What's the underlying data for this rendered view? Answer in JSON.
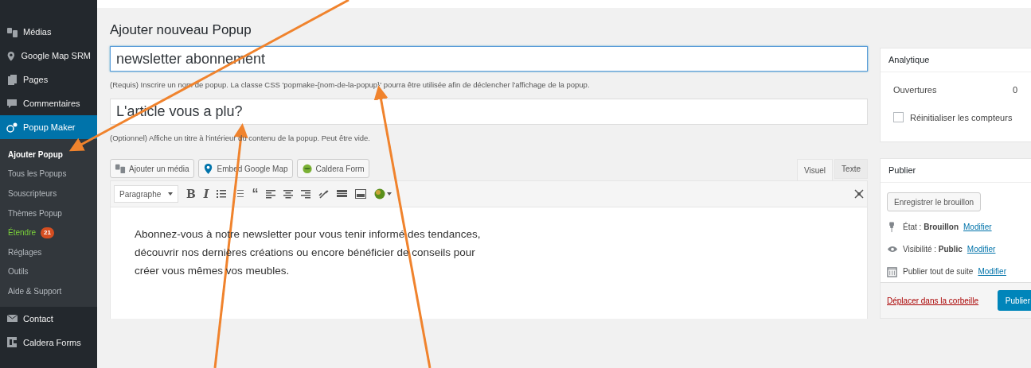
{
  "sidebar": {
    "items": [
      {
        "label": "Médias",
        "selected": false
      },
      {
        "label": "Google Map SRM",
        "selected": false
      },
      {
        "label": "Pages",
        "selected": false
      },
      {
        "label": "Commentaires",
        "selected": false
      },
      {
        "label": "Popup Maker",
        "selected": true,
        "children": [
          {
            "label": "Ajouter Popup",
            "selected": true
          },
          {
            "label": "Tous les Popups",
            "selected": false
          },
          {
            "label": "Souscripteurs",
            "selected": false
          },
          {
            "label": "Thèmes Popup",
            "selected": false
          },
          {
            "label": "Étendre",
            "selected": false,
            "color": "#7ad03a",
            "badge": "21"
          },
          {
            "label": "Réglages",
            "selected": false
          },
          {
            "label": "Outils",
            "selected": false
          },
          {
            "label": "Aide & Support",
            "selected": false
          }
        ]
      },
      {
        "label": "Contact",
        "selected": false
      },
      {
        "label": "Caldera Forms",
        "selected": false
      }
    ]
  },
  "page_title": "Ajouter nouveau Popup",
  "name_field": {
    "value": "newsletter abonnement",
    "help": "(Requis) Inscrire un nom de popup. La classe CSS 'popmake-{nom-de-la-popup}' pourra être utilisée afin de déclencher l'affichage de la popup."
  },
  "title_field": {
    "value": "L'article vous a plu?",
    "help": "(Optionnel) Affiche un titre à l'intérieur du contenu de la popup. Peut être vide."
  },
  "media_buttons": [
    {
      "label": "Ajouter un média"
    },
    {
      "label": "Embed Google Map"
    },
    {
      "label": "Caldera Form"
    }
  ],
  "editor_tabs": [
    {
      "label": "Visuel",
      "selected": true
    },
    {
      "label": "Texte",
      "selected": false
    }
  ],
  "format_select": {
    "value": "Paragraphe"
  },
  "toolbar_glyphs": [
    "B",
    "I",
    "“"
  ],
  "editor_content": "Abonnez-vous à notre newsletter pour vous tenir informé des tendances, découvrir nos dernières créations ou encore bénéficier de conseils pour créer vous mêmes vos meubles.",
  "analytics": {
    "title": "Analytique",
    "rows": [
      {
        "label": "Ouvertures",
        "value": "0"
      }
    ],
    "reset": {
      "label": "Réinitialiser les compteurs",
      "checked": false
    }
  },
  "publish": {
    "title": "Publier",
    "save_button": "Enregistrer le brouillon",
    "meta": [
      {
        "label": "État : ",
        "value": "Brouillon",
        "link": "Modifier"
      },
      {
        "label": "Visibilité : ",
        "value": "Public",
        "link": "Modifier"
      },
      {
        "label": "Publier tout de suite",
        "link": "Modifier"
      }
    ],
    "trash_link": "Déplacer dans la corbeille",
    "publish_button": "Publier"
  }
}
